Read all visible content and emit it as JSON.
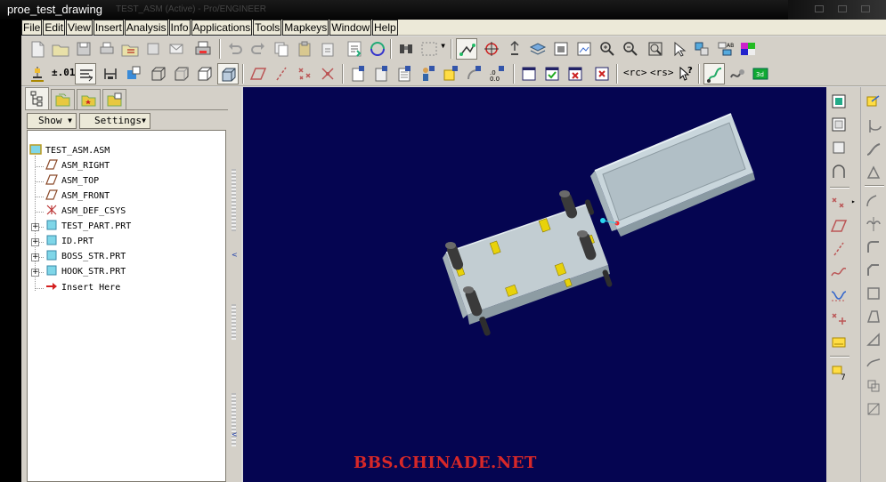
{
  "window": {
    "title": "proe_test_drawing",
    "ghost_title": "TEST_ASM (Active) - Pro/ENGINEER"
  },
  "menu": [
    "File",
    "Edit",
    "View",
    "Insert",
    "Analysis",
    "Info",
    "Applications",
    "Tools",
    "Mapkeys",
    "Window",
    "Help"
  ],
  "toolbar": {
    "tolerance_label": "±.01",
    "rc_label": "<rc>",
    "rs_label": "<rs>"
  },
  "panel": {
    "show_label": "Show",
    "settings_label": "Settings"
  },
  "tree": {
    "root": "TEST_ASM.ASM",
    "datums": [
      "ASM_RIGHT",
      "ASM_TOP",
      "ASM_FRONT",
      "ASM_DEF_CSYS"
    ],
    "parts": [
      "TEST_PART.PRT",
      "ID.PRT",
      "BOSS_STR.PRT",
      "HOOK_STR.PRT"
    ],
    "insert_here": "Insert Here"
  },
  "viewport": {
    "background": "#050551",
    "watermark": "BBS.CHINADE.NET",
    "watermark_color": "#d82828"
  },
  "icons": [
    "new-icon",
    "open-icon",
    "save-icon",
    "print-icon",
    "undo-icon",
    "redo-icon",
    "copy-icon",
    "regenerate-icon",
    "zoom-in-icon",
    "zoom-out-icon",
    "refit-icon",
    "datum-plane-icon",
    "datum-axis-icon",
    "csys-icon",
    "sketch-icon",
    "hole-icon",
    "round-icon",
    "chamfer-icon"
  ]
}
